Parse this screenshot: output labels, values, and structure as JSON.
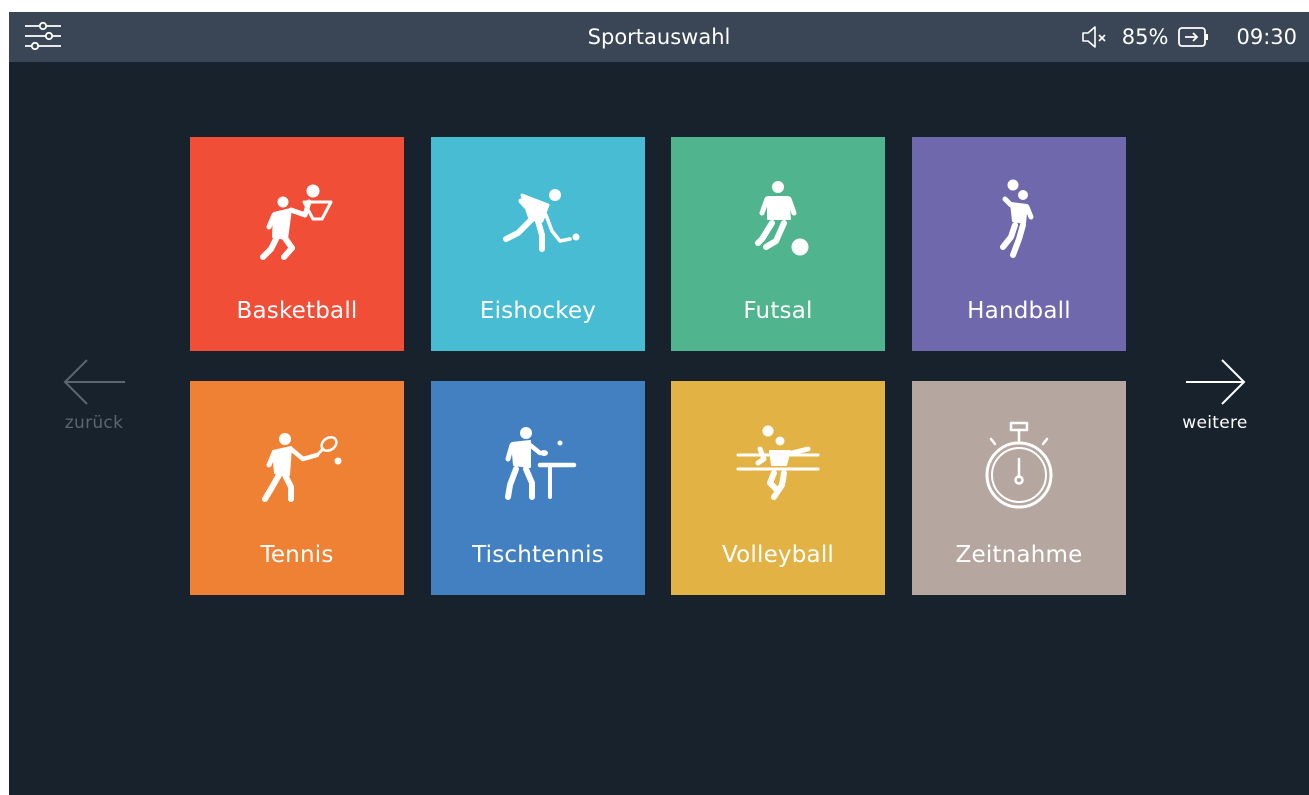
{
  "header": {
    "title": "Sportauswahl",
    "battery_percent": "85%",
    "time": "09:30",
    "settings_icon": "sliders-icon",
    "volume_icon": "volume-muted-icon",
    "battery_icon": "battery-charging-icon"
  },
  "nav": {
    "back_label": "zurück",
    "next_label": "weitere"
  },
  "tiles": [
    {
      "label": "Basketball",
      "icon": "basketball-icon",
      "color": "#f04e37"
    },
    {
      "label": "Eishockey",
      "icon": "ice-hockey-icon",
      "color": "#47bcd3"
    },
    {
      "label": "Futsal",
      "icon": "futsal-icon",
      "color": "#50b48f"
    },
    {
      "label": "Handball",
      "icon": "handball-icon",
      "color": "#7068ad"
    },
    {
      "label": "Tennis",
      "icon": "tennis-icon",
      "color": "#ef8134"
    },
    {
      "label": "Tischtennis",
      "icon": "table-tennis-icon",
      "color": "#4380c1"
    },
    {
      "label": "Volleyball",
      "icon": "volleyball-icon",
      "color": "#e2b344"
    },
    {
      "label": "Zeitnahme",
      "icon": "stopwatch-icon",
      "color": "#b5a69f"
    }
  ],
  "colors": {
    "background": "#18222d",
    "topbar": "#3a4655",
    "back_nav": "#5b6673",
    "next_nav": "#ffffff"
  }
}
